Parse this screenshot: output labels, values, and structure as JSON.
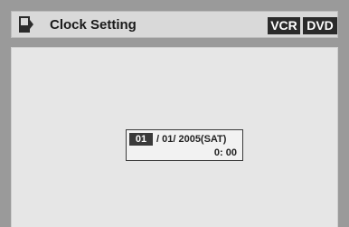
{
  "header": {
    "title": "Clock Setting",
    "badges": {
      "vcr": "VCR",
      "dvd": "DVD"
    },
    "icon": "clock-icon"
  },
  "clock": {
    "month": "01",
    "date_rest": "/ 01/ 2005(SAT)",
    "time": "0: 00"
  },
  "colors": {
    "frame": "#9a9a9a",
    "header_bg": "#d9d9d9",
    "content_bg": "#e6e6e6",
    "badge_bg": "#2b2b2b",
    "selected_field": "#3a3a3a"
  }
}
